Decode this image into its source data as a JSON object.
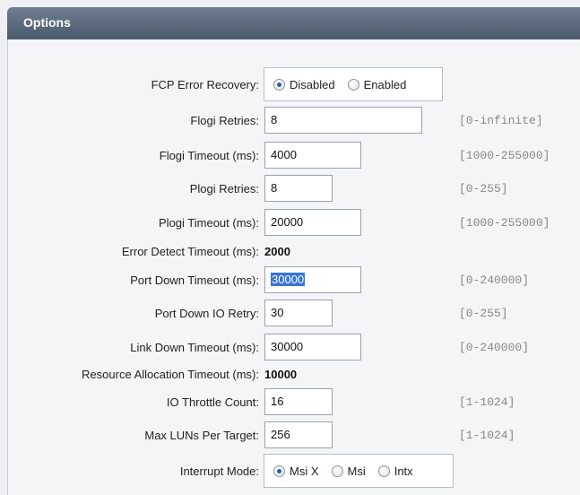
{
  "header": {
    "title": "Options"
  },
  "fcp": {
    "label": "FCP Error Recovery:",
    "options": [
      {
        "label": "Disabled",
        "checked": true
      },
      {
        "label": "Enabled",
        "checked": false
      }
    ]
  },
  "flogi_retries": {
    "label": "Flogi Retries:",
    "value": "8",
    "range": "[0-infinite]"
  },
  "flogi_timeout": {
    "label": "Flogi Timeout (ms):",
    "value": "4000",
    "range": "[1000-255000]"
  },
  "plogi_retries": {
    "label": "Plogi Retries:",
    "value": "8",
    "range": "[0-255]"
  },
  "plogi_timeout": {
    "label": "Plogi Timeout (ms):",
    "value": "20000",
    "range": "[1000-255000]"
  },
  "error_detect": {
    "label": "Error Detect Timeout (ms):",
    "value": "2000"
  },
  "port_down_timeout": {
    "label": "Port Down Timeout (ms):",
    "value": "30000",
    "range": "[0-240000]"
  },
  "port_down_io_retry": {
    "label": "Port Down IO Retry:",
    "value": "30",
    "range": "[0-255]"
  },
  "link_down_timeout": {
    "label": "Link Down Timeout (ms):",
    "value": "30000",
    "range": "[0-240000]"
  },
  "resource_alloc": {
    "label": "Resource Allocation Timeout (ms):",
    "value": "10000"
  },
  "io_throttle": {
    "label": "IO Throttle Count:",
    "value": "16",
    "range": "[1-1024]"
  },
  "max_luns": {
    "label": "Max LUNs Per Target:",
    "value": "256",
    "range": "[1-1024]"
  },
  "interrupt": {
    "label": "Interrupt Mode:",
    "options": [
      {
        "label": "Msi X",
        "checked": true
      },
      {
        "label": "Msi",
        "checked": false
      },
      {
        "label": "Intx",
        "checked": false
      }
    ]
  }
}
